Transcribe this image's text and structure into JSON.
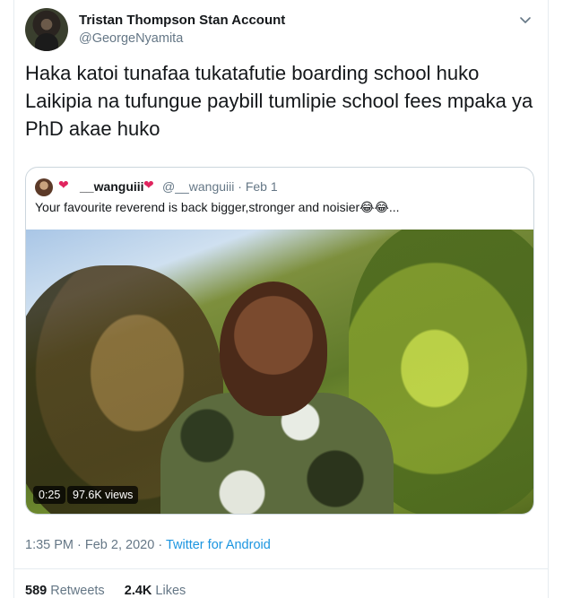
{
  "author": {
    "name": "Tristan Thompson Stan Account",
    "handle": "@GeorgeNyamita"
  },
  "tweet": {
    "text": "Haka katoi tunafaa tukatafutie boarding school huko Laikipia na tufungue paybill tumlipie school fees mpaka ya PhD akae huko"
  },
  "quoted_tweet": {
    "name": "__wanguiii",
    "handle": "@__wanguiii",
    "separator": "·",
    "date": "Feb 1",
    "text": "Your favourite reverend is back bigger,stronger and noisier😂😂...",
    "media": {
      "duration": "0:25",
      "views": "97.6K views"
    }
  },
  "meta": {
    "time": "1:35 PM",
    "date": "Feb 2, 2020",
    "source": "Twitter for Android"
  },
  "stats": {
    "retweets_count": "589",
    "retweets_label": "Retweets",
    "likes_count": "2.4K",
    "likes_label": "Likes"
  },
  "icons": {
    "menu": "chevron-down-icon",
    "heart": "heart-icon"
  },
  "colors": {
    "link": "#1b95e0",
    "secondary_text": "#657786",
    "border": "#e6ecf0"
  }
}
